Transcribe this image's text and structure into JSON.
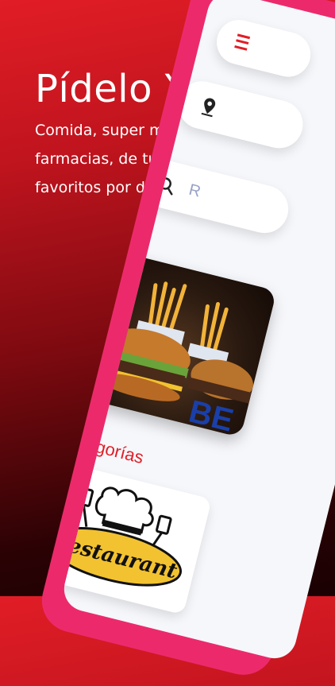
{
  "hero": {
    "title": "Pídelo Ya",
    "tagline": "Comida, super mercados, farmacias, de tus lugares favoritos por delivery"
  },
  "app": {
    "search_placeholder": "R",
    "promo_overlay_text": "BE",
    "categories_title": "Categorías",
    "category_card_label": "Restaurant"
  },
  "colors": {
    "brand_red": "#e11d26",
    "frame_pink": "#ec2a6b",
    "screen_bg": "#f6f7fb"
  },
  "icons": {
    "menu": "hamburger-menu-icon",
    "location": "location-pin-icon",
    "search": "search-icon",
    "chef": "chef-hat-icon"
  }
}
